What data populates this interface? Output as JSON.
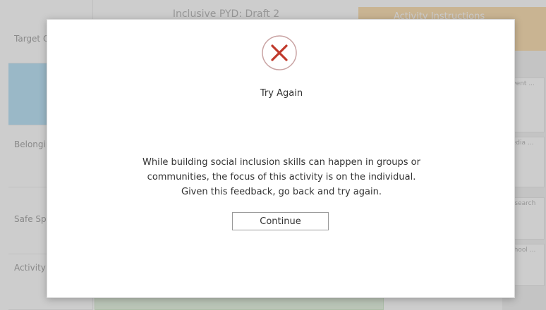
{
  "background": {
    "left_rows": [
      "Target Outcomes",
      "",
      "Belonging and Membership",
      "Safe Spaces",
      "Activity options do not"
    ],
    "header_mid": "Inclusive PYD: Draft 2",
    "header_right": "Activity Instructions",
    "right_cards": [
      "Invent ...",
      "Media ...",
      "Research ...",
      "School ..."
    ]
  },
  "dialog": {
    "icon": "close-x-circle-icon",
    "accent_color": "#c0392b",
    "title": "Try Again",
    "message_lines": [
      "While building social inclusion skills can happen in groups or",
      "communities, the focus of this activity is on the individual.",
      "Given this feedback, go back and try again."
    ],
    "continue_label": "Continue"
  }
}
